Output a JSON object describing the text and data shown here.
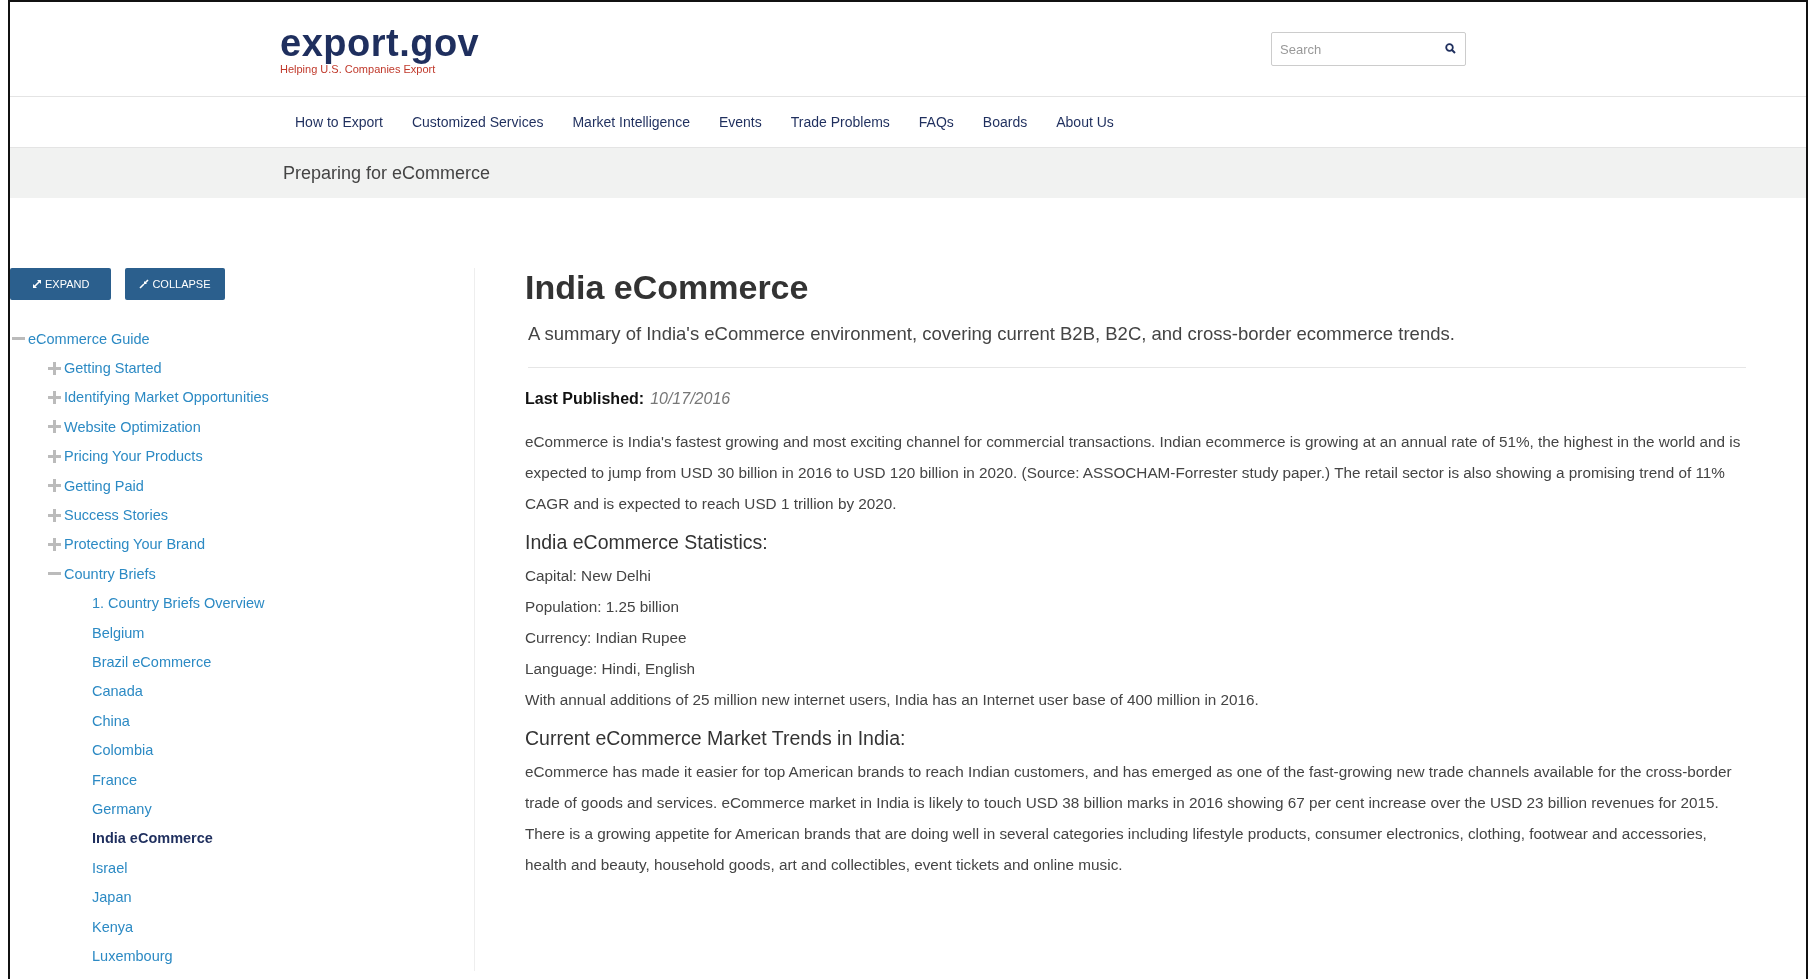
{
  "header": {
    "logo": "export.gov",
    "tagline": "Helping U.S. Companies Export",
    "search": {
      "placeholder": "Search"
    }
  },
  "nav": [
    "How to Export",
    "Customized Services",
    "Market Intelligence",
    "Events",
    "Trade Problems",
    "FAQs",
    "Boards",
    "About Us"
  ],
  "breadcrumb": "Preparing for eCommerce",
  "sidebar": {
    "buttons": [
      {
        "kind": "expand",
        "label": "EXPAND"
      },
      {
        "kind": "collapse",
        "label": "COLLAPSE"
      }
    ],
    "tree": [
      {
        "label": "eCommerce Guide",
        "expanded": true,
        "selected": false,
        "children": [
          {
            "label": "Getting Started",
            "expanded": false,
            "selected": false
          },
          {
            "label": "Identifying Market Opportunities",
            "expanded": false,
            "selected": false
          },
          {
            "label": "Website Optimization",
            "expanded": false,
            "selected": false
          },
          {
            "label": "Pricing Your Products",
            "expanded": false,
            "selected": false
          },
          {
            "label": "Getting Paid",
            "expanded": false,
            "selected": false
          },
          {
            "label": "Success Stories",
            "expanded": false,
            "selected": false
          },
          {
            "label": "Protecting Your Brand",
            "expanded": false,
            "selected": false
          },
          {
            "label": "Country Briefs",
            "expanded": true,
            "selected": false,
            "children": [
              {
                "label": "1. Country Briefs Overview",
                "selected": false
              },
              {
                "label": "Belgium",
                "selected": false
              },
              {
                "label": "Brazil eCommerce",
                "selected": false
              },
              {
                "label": "Canada",
                "selected": false
              },
              {
                "label": "China",
                "selected": false
              },
              {
                "label": "Colombia",
                "selected": false
              },
              {
                "label": "France",
                "selected": false
              },
              {
                "label": "Germany",
                "selected": false
              },
              {
                "label": "India eCommerce",
                "selected": true
              },
              {
                "label": "Israel",
                "selected": false
              },
              {
                "label": "Japan",
                "selected": false
              },
              {
                "label": "Kenya",
                "selected": false
              },
              {
                "label": "Luxembourg",
                "selected": false
              }
            ]
          }
        ]
      }
    ]
  },
  "article": {
    "title": "India eCommerce",
    "summary": "A summary of India's eCommerce environment, covering current B2B, B2C, and cross-border ecommerce trends.",
    "published_label": "Last Published:",
    "published_date": "10/17/2016",
    "intro": "eCommerce is India's fastest growing and most exciting channel for commercial transactions. Indian ecommerce is growing at an annual rate of 51%, the highest in the world and is expected to jump from USD 30 billion in 2016 to USD 120 billion in 2020. (Source: ASSOCHAM-Forrester study paper.) The retail sector is also showing a promising trend of 11% CAGR and is expected to reach USD 1 trillion by 2020.",
    "sections": [
      {
        "heading": "India eCommerce Statistics:",
        "lines": [
          "Capital: New Delhi",
          "Population: 1.25 billion",
          "Currency: Indian Rupee",
          "Language: Hindi, English",
          "With annual additions of 25 million new internet users, India has an Internet user base of 400 million in 2016."
        ]
      },
      {
        "heading": "Current eCommerce Market Trends in India:",
        "paragraph": "eCommerce has made it easier for top American brands to reach Indian customers, and has emerged as one of the fast-growing new trade channels available for the cross-border trade of goods and services. eCommerce market in India is likely to touch USD 38 billion marks in 2016 showing 67 per cent increase over the USD 23 billion revenues for 2015. There is a growing appetite for American brands that are doing well in several categories including lifestyle products, consumer electronics, clothing, footwear and accessories, health and beauty, household goods, art and collectibles, event tickets and online music."
      }
    ]
  }
}
